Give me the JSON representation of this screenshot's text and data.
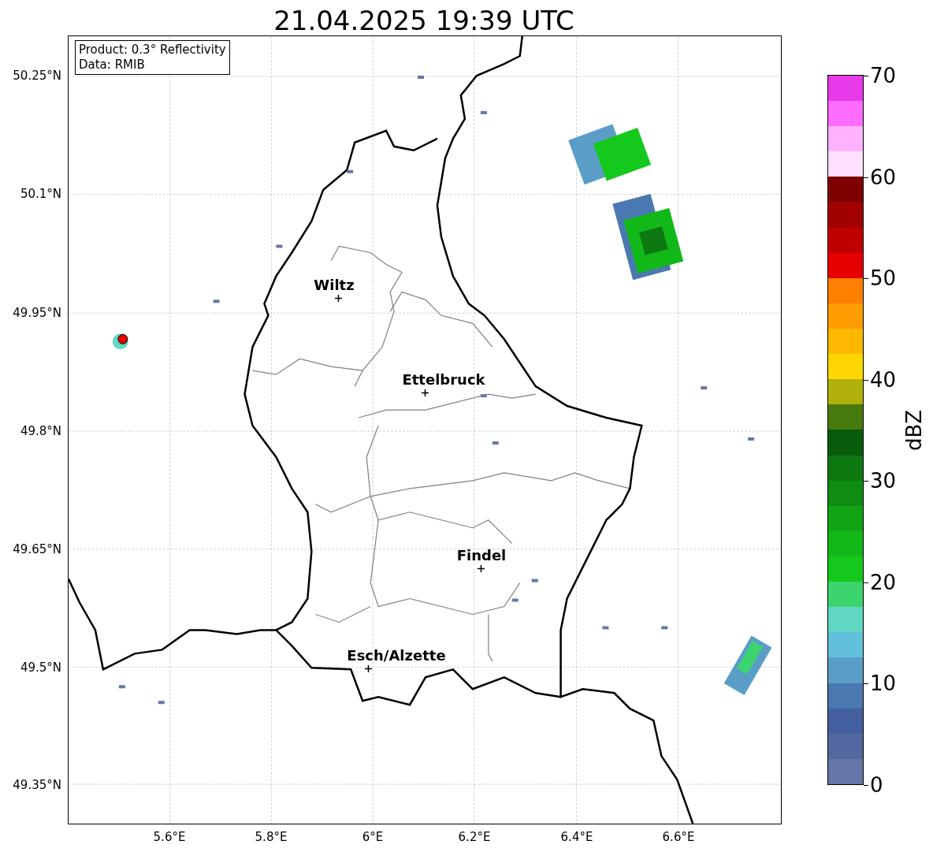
{
  "title": "21.04.2025 19:39 UTC",
  "map": {
    "info_box": [
      "Product: 0.3° Reflectivity",
      "Data: RMIB"
    ],
    "lat_labels": [
      "50.25°N",
      "50.1°N",
      "49.95°N",
      "49.8°N",
      "49.65°N",
      "49.5°N",
      "49.35°N"
    ],
    "lon_labels": [
      "5.6°E",
      "5.8°E",
      "6°E",
      "6.2°E",
      "6.4°E",
      "6.6°E"
    ],
    "places": [
      {
        "name": "Wiltz"
      },
      {
        "name": "Ettelbruck"
      },
      {
        "name": "Findel"
      },
      {
        "name": "Esch/Alzette"
      }
    ]
  },
  "colorbar": {
    "label": "dBZ",
    "ticks": [
      "70",
      "60",
      "50",
      "40",
      "30",
      "20",
      "10",
      "0"
    ],
    "bins": [
      {
        "color": "#6577a8"
      },
      {
        "color": "#53689e"
      },
      {
        "color": "#4460a0"
      },
      {
        "color": "#4a78b0"
      },
      {
        "color": "#5a9ec8"
      },
      {
        "color": "#62c0dc"
      },
      {
        "color": "#60d8c4"
      },
      {
        "color": "#3cd46c"
      },
      {
        "color": "#14c81c"
      },
      {
        "color": "#12b818"
      },
      {
        "color": "#11a414"
      },
      {
        "color": "#108c12"
      },
      {
        "color": "#0e7810"
      },
      {
        "color": "#075c0c"
      },
      {
        "color": "#477a0c"
      },
      {
        "color": "#b0b00a"
      },
      {
        "color": "#ffd700"
      },
      {
        "color": "#ffb800"
      },
      {
        "color": "#ff9c00"
      },
      {
        "color": "#ff7f00"
      },
      {
        "color": "#e60000"
      },
      {
        "color": "#c00000"
      },
      {
        "color": "#a00000"
      },
      {
        "color": "#7e0000"
      },
      {
        "color": "#ffe0ff"
      },
      {
        "color": "#ffb2ff"
      },
      {
        "color": "#ff6cff"
      },
      {
        "color": "#e83ae8"
      }
    ]
  }
}
